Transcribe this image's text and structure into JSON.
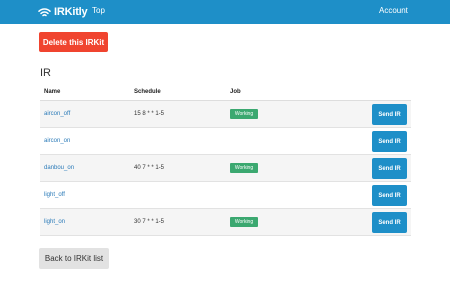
{
  "nav": {
    "brand": "IRKitly",
    "brand_icon": "wifi-icon",
    "top": "Top",
    "account": "Account",
    "bar_color": "#1e8fc8"
  },
  "actions": {
    "delete_label": "Delete this IRKit",
    "delete_color": "#f0442f",
    "back_label": "Back to IRKit list"
  },
  "section": {
    "title": "IR"
  },
  "table": {
    "headers": {
      "name": "Name",
      "schedule": "Schedule",
      "job": "Job"
    },
    "send_label": "Send IR",
    "badge_color": "#3ba870",
    "rows": [
      {
        "name": "aircon_off",
        "schedule": "15 8 * * 1-5",
        "job": "Working"
      },
      {
        "name": "aircon_on",
        "schedule": "",
        "job": ""
      },
      {
        "name": "danbou_on",
        "schedule": "40 7 * * 1-5",
        "job": "Working"
      },
      {
        "name": "light_off",
        "schedule": "",
        "job": ""
      },
      {
        "name": "light_on",
        "schedule": "30 7 * * 1-5",
        "job": "Working"
      }
    ]
  }
}
